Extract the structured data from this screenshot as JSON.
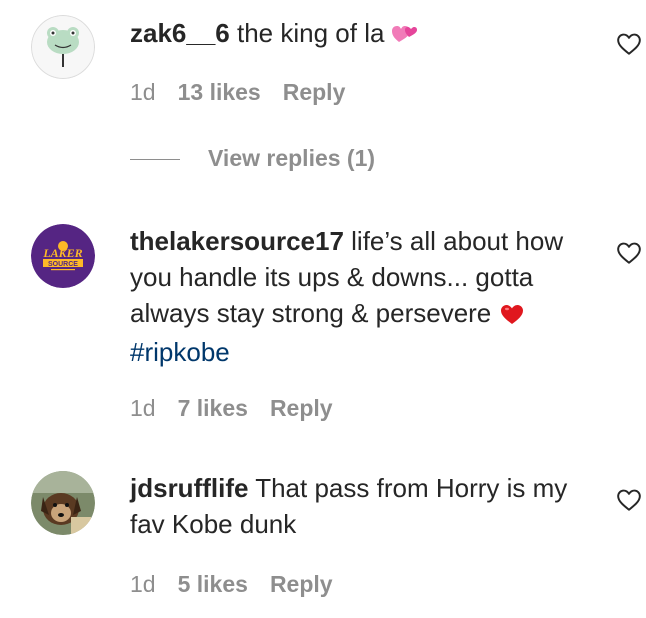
{
  "comments": [
    {
      "username": "zak6__6",
      "text": "the king of la",
      "emoji": "two-hearts",
      "time": "1d",
      "likes": "13 likes",
      "reply": "Reply",
      "view_replies": "View replies (1)"
    },
    {
      "username": "thelakersource17",
      "text": "life’s all about how you handle its ups & downs... gotta always stay strong & persevere",
      "emoji": "red-heart",
      "hashtag": "#ripkobe",
      "avatar_text_top": "LAKER",
      "avatar_text_bottom": "SOURCE",
      "time": "1d",
      "likes": "7 likes",
      "reply": "Reply"
    },
    {
      "username": "jdsrufflife",
      "text": "That pass from Horry is my fav Kobe dunk",
      "time": "1d",
      "likes": "5 likes",
      "reply": "Reply"
    }
  ],
  "colors": {
    "text": "#262626",
    "secondary": "#8e8e8e",
    "hashtag": "#00376b",
    "laker_purple": "#552583",
    "laker_gold": "#fdb927"
  }
}
